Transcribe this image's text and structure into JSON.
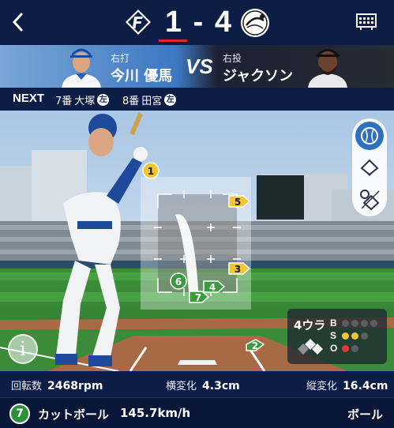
{
  "header": {
    "home_team_icon": "fighters-f-logo",
    "score": "1 - 4",
    "away_team_icon": "marines-chiba-lotte-logo",
    "scoreboard_icon": "scoreboard-icon",
    "back_icon": "back-chevron-icon"
  },
  "matchup": {
    "batter_role": "右打",
    "batter_name": "今川 優馬",
    "vs": "VS",
    "pitcher_role": "右投",
    "pitcher_name": "ジャクソン"
  },
  "next": {
    "label": "NEXT",
    "batters": [
      {
        "order": "7番",
        "name": "大塚",
        "hand": "左"
      },
      {
        "order": "8番",
        "name": "田宮",
        "hand": "左"
      }
    ]
  },
  "pitch_markers": [
    {
      "num": "1",
      "color": "#f2c531"
    },
    {
      "num": "2",
      "color": "#3c9a3e"
    },
    {
      "num": "3",
      "color": "#f2c531"
    },
    {
      "num": "4",
      "color": "#3c9a3e"
    },
    {
      "num": "5",
      "color": "#f2c531"
    },
    {
      "num": "6",
      "color": "#3c9a3e"
    },
    {
      "num": "7",
      "color": "#3c9a3e"
    }
  ],
  "count": {
    "outs_label": "4ウラ",
    "balls_label": "B",
    "strikes_label": "S",
    "outs_letter": "O",
    "balls": 0,
    "strikes": 2,
    "outs": 1
  },
  "colors": {
    "ball": "#3fbf4a",
    "strike": "#f2c531",
    "out": "#e53935",
    "navy": "#0c1d46"
  },
  "stats": {
    "spin_label": "回転数",
    "spin_value": "2468rpm",
    "hbreak_label": "横変化",
    "hbreak_value": "4.3cm",
    "vbreak_label": "縦変化",
    "vbreak_value": "16.4cm"
  },
  "pitch": {
    "number": "7",
    "type": "カットボール",
    "speed": "145.7km/h",
    "result": "ボール"
  }
}
